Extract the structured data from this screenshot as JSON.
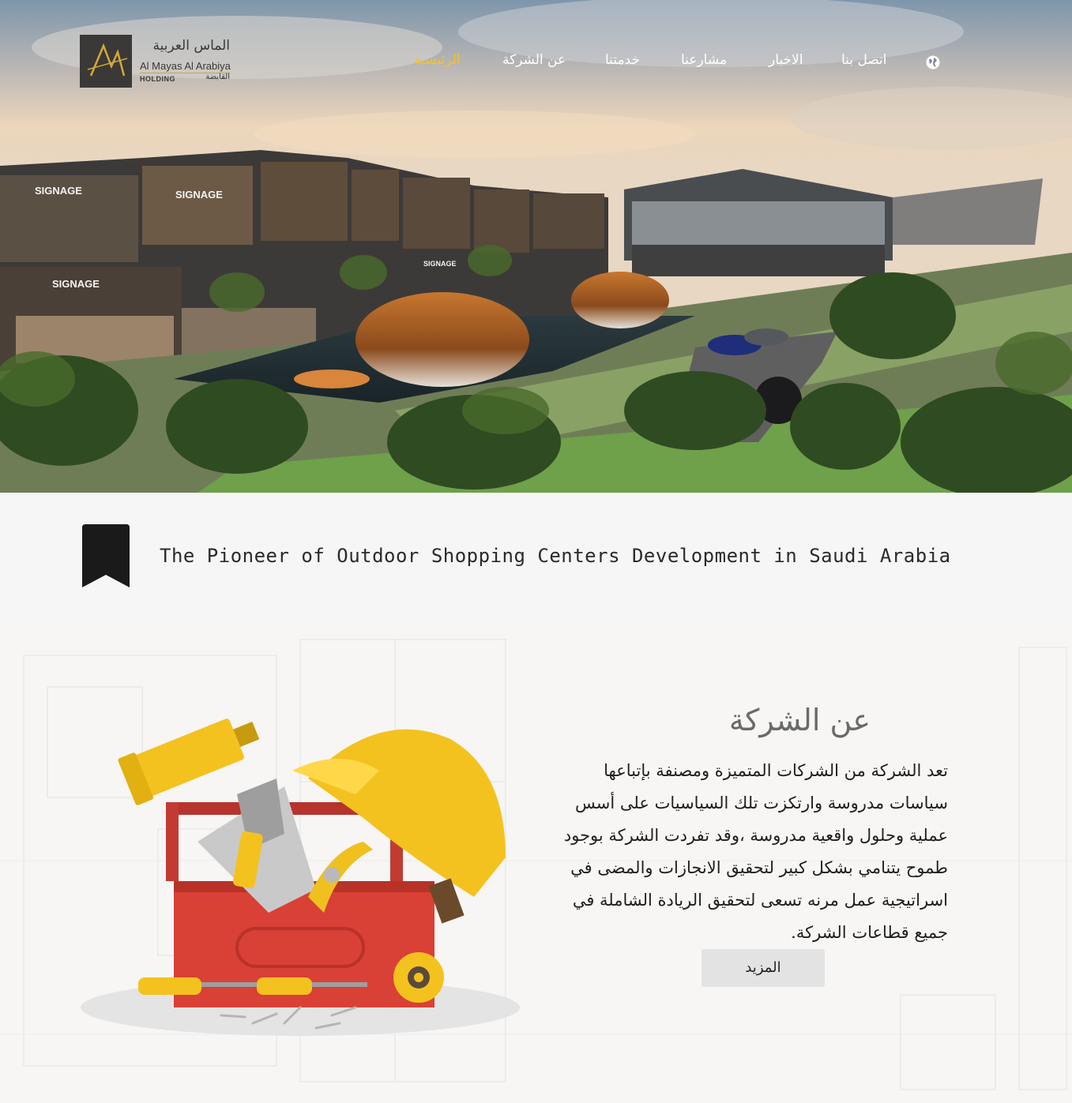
{
  "logo": {
    "arabic_name": "الماس العربية",
    "english_name": "Al Mayas Al Arabiya",
    "holding_en": "HOLDING",
    "holding_ar": "القابضة"
  },
  "nav": {
    "items": [
      {
        "label": "الرئيسية",
        "active": true
      },
      {
        "label": "عن الشركة",
        "active": false
      },
      {
        "label": "خدمتنا",
        "active": false
      },
      {
        "label": "مشارعنا",
        "active": false
      },
      {
        "label": "الاخبار",
        "active": false
      },
      {
        "label": "اتصل بنا",
        "active": false
      }
    ],
    "language_icon": "globe-icon"
  },
  "hero": {
    "signage_texts": [
      "SIGNAGE",
      "SIGNAGE",
      "SIGNAGE",
      "SIGNAGE"
    ]
  },
  "tagline": {
    "text": "The Pioneer of Outdoor Shopping Centers Development in Saudi Arabia",
    "icon": "bookmark-icon"
  },
  "about": {
    "title": "عن الشركة",
    "body": "تعد الشركة من الشركات المتميزة ومصنفة بإتباعها سياسات مدروسة وارتكزت تلك السياسيات على أسس عملية وحلول واقعية مدروسة ،وقد تفردت الشركة بوجود طموح يتنامي بشكل كبير لتحقيق الانجازات والمضى في اسراتيجية عمل مرنه تسعى لتحقيق الريادة الشاملة في جميع قطاعات الشركة.",
    "more_button": "المزيد",
    "illustration": "toolbox-illustration"
  },
  "colors": {
    "accent": "#f2c233",
    "nav_text": "#ffffff",
    "band_bg": "#f6f6f6",
    "button_bg": "#e3e3e3"
  }
}
